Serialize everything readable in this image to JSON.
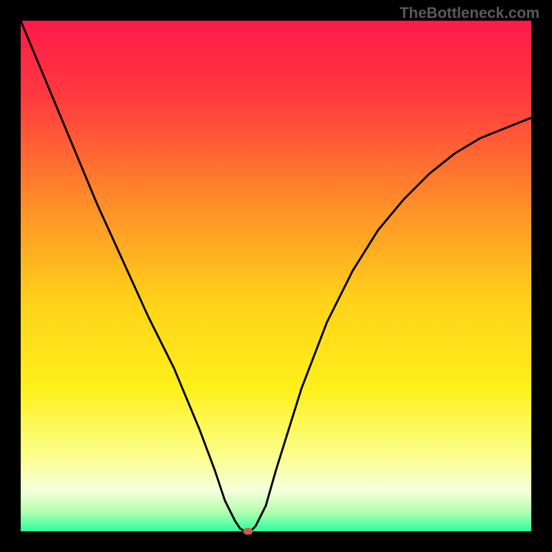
{
  "watermark": "TheBottleneck.com",
  "chart_data": {
    "type": "line",
    "title": "",
    "xlabel": "",
    "ylabel": "",
    "xlim": [
      0,
      100
    ],
    "ylim": [
      0,
      100
    ],
    "background": {
      "type": "vertical-gradient",
      "stops": [
        {
          "offset": 0.0,
          "color": "#ff1a4a"
        },
        {
          "offset": 0.15,
          "color": "#ff3a3f"
        },
        {
          "offset": 0.35,
          "color": "#ff8a2a"
        },
        {
          "offset": 0.55,
          "color": "#ffd21a"
        },
        {
          "offset": 0.72,
          "color": "#fff01a"
        },
        {
          "offset": 0.85,
          "color": "#fcff8a"
        },
        {
          "offset": 0.92,
          "color": "#f5ffdc"
        },
        {
          "offset": 0.96,
          "color": "#b8ffb0"
        },
        {
          "offset": 1.0,
          "color": "#2affa0"
        }
      ]
    },
    "series": [
      {
        "name": "bottleneck-curve",
        "color": "#000000",
        "x": [
          0,
          5,
          10,
          15,
          20,
          25,
          30,
          35,
          38,
          40,
          42,
          43,
          44,
          45,
          46,
          48,
          50,
          55,
          60,
          65,
          70,
          75,
          80,
          85,
          90,
          95,
          100
        ],
        "y": [
          100,
          88,
          76,
          64,
          53,
          42,
          32,
          20,
          12,
          6,
          2,
          0.5,
          0,
          0,
          1,
          5,
          12,
          28,
          41,
          51,
          59,
          65,
          70,
          74,
          77,
          79,
          81
        ]
      }
    ],
    "marker": {
      "name": "optimal-point",
      "x": 44.5,
      "y": 0,
      "color": "#d05a4a",
      "rx": 7,
      "ry": 5
    },
    "frame": {
      "border_width": 30,
      "inner_left": 30,
      "inner_top": 30,
      "inner_width": 740,
      "inner_height": 740,
      "color": "#000000"
    }
  }
}
